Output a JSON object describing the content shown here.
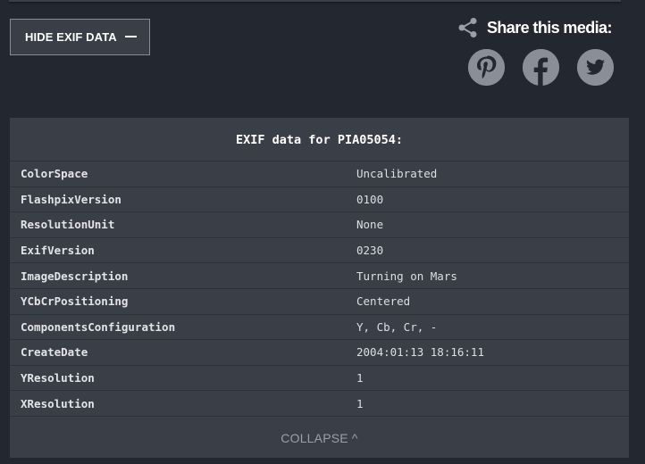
{
  "hide_button": {
    "label": "HIDE EXIF DATA"
  },
  "share": {
    "title": "Share this media:",
    "networks": [
      "pinterest",
      "facebook",
      "twitter"
    ]
  },
  "exif": {
    "title": "EXIF data for PIA05054:",
    "rows": [
      {
        "key": "ColorSpace",
        "value": "Uncalibrated"
      },
      {
        "key": "FlashpixVersion",
        "value": "0100"
      },
      {
        "key": "ResolutionUnit",
        "value": "None"
      },
      {
        "key": "ExifVersion",
        "value": "0230"
      },
      {
        "key": "ImageDescription",
        "value": "Turning on Mars"
      },
      {
        "key": "YCbCrPositioning",
        "value": "Centered"
      },
      {
        "key": "ComponentsConfiguration",
        "value": "Y, Cb, Cr, -"
      },
      {
        "key": "CreateDate",
        "value": "2004:01:13 18:16:11"
      },
      {
        "key": "YResolution",
        "value": "1"
      },
      {
        "key": "XResolution",
        "value": "1"
      }
    ],
    "collapse_label": "COLLAPSE ^"
  },
  "colors": {
    "background": "#23272f",
    "panel": "#3a3e46",
    "icon": "#8a8f97"
  }
}
